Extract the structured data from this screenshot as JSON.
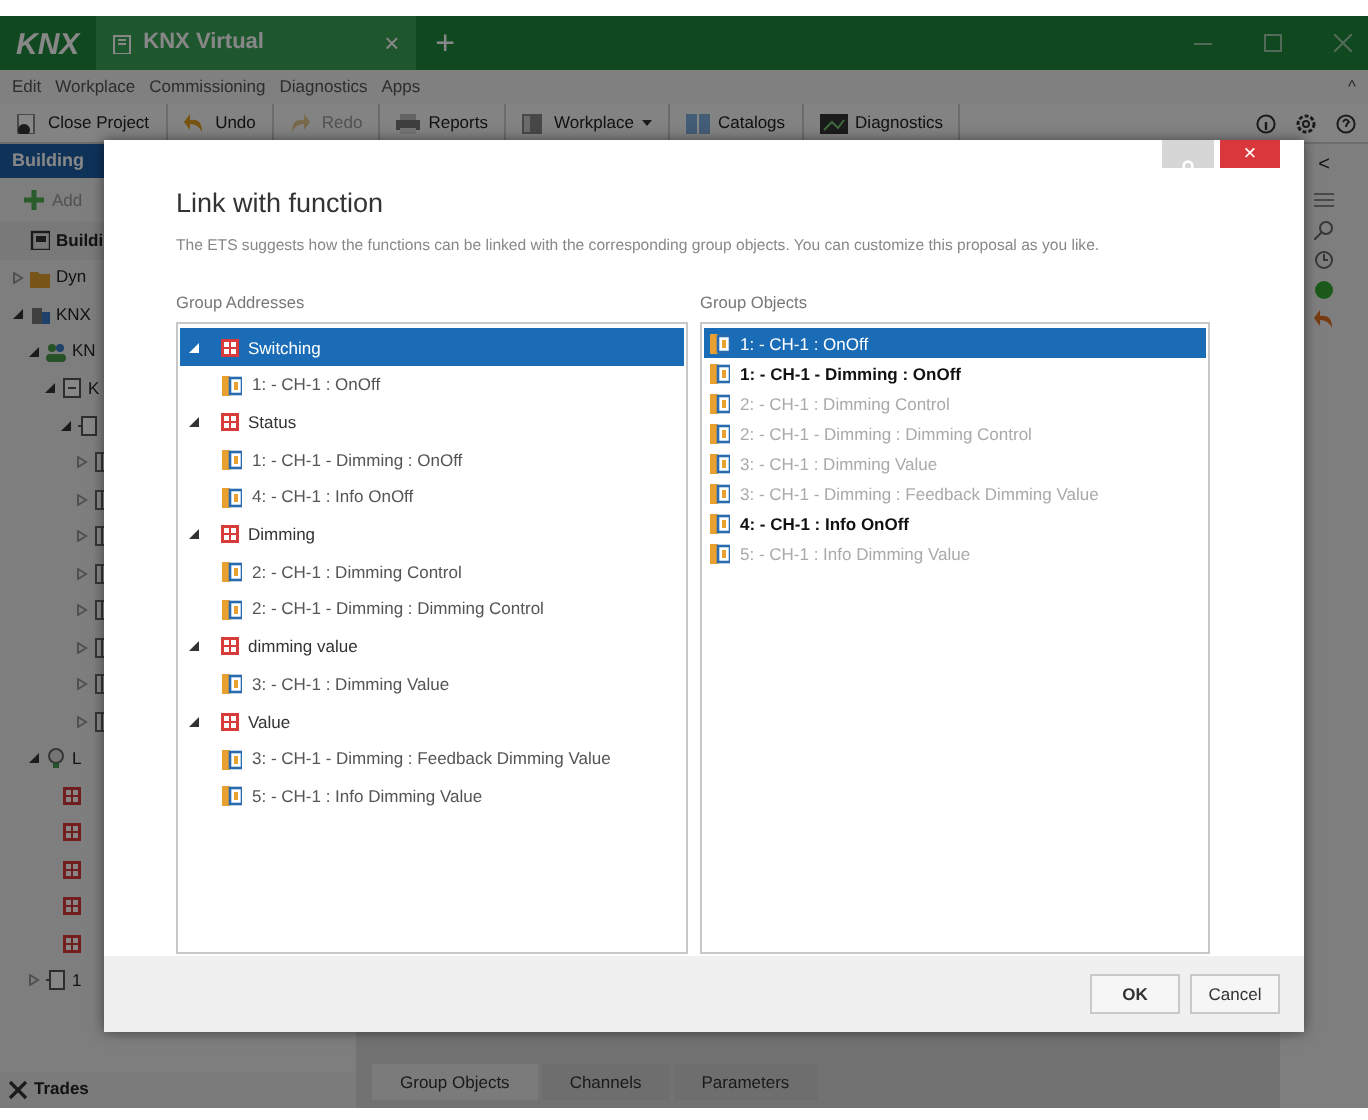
{
  "app": {
    "logo": "KNX",
    "tab": {
      "title": "KNX Virtual",
      "close": "×"
    },
    "new_tab": "+",
    "menu": [
      "Edit",
      "Workplace",
      "Commissioning",
      "Diagnostics",
      "Apps"
    ],
    "menu_collapse": "^",
    "toolbar": [
      {
        "label": "Close Project",
        "kind": "close",
        "disabled": false,
        "dropdown": false
      },
      {
        "label": "Undo",
        "kind": "undo",
        "disabled": false,
        "dropdown": false
      },
      {
        "label": "Redo",
        "kind": "redo",
        "disabled": true,
        "dropdown": false
      },
      {
        "label": "Reports",
        "kind": "printer",
        "disabled": false,
        "dropdown": false
      },
      {
        "label": "Workplace",
        "kind": "panes",
        "disabled": false,
        "dropdown": true
      },
      {
        "label": "Catalogs",
        "kind": "book",
        "disabled": false,
        "dropdown": false
      },
      {
        "label": "Diagnostics",
        "kind": "monitor",
        "disabled": false,
        "dropdown": false
      }
    ],
    "sidebar": {
      "title": "Building",
      "add": "Add",
      "footer": "Trades",
      "tree": [
        {
          "label": "Buildi",
          "kind": "building-view"
        },
        {
          "label": "Dyn",
          "kind": "folder",
          "expanded": false
        },
        {
          "label": "KNX",
          "kind": "building",
          "expanded": true,
          "children": [
            {
              "label": "KN",
              "kind": "people",
              "expanded": true,
              "children": [
                {
                  "label": "K",
                  "kind": "cabinet",
                  "expanded": true,
                  "children": [
                    {
                      "kind": "room",
                      "expanded": true,
                      "children": [
                        {
                          "kind": "device",
                          "expanded": false
                        },
                        {
                          "kind": "device",
                          "expanded": false
                        },
                        {
                          "kind": "device",
                          "expanded": false
                        },
                        {
                          "kind": "device",
                          "expanded": false
                        },
                        {
                          "kind": "device",
                          "expanded": false
                        },
                        {
                          "kind": "device",
                          "expanded": false
                        },
                        {
                          "kind": "device",
                          "expanded": false
                        },
                        {
                          "kind": "device",
                          "expanded": false
                        }
                      ]
                    }
                  ]
                }
              ]
            },
            {
              "label": "L",
              "kind": "bulb",
              "expanded": true,
              "children": [
                {
                  "kind": "group-address"
                },
                {
                  "kind": "group-address"
                },
                {
                  "kind": "group-address"
                },
                {
                  "kind": "group-address"
                },
                {
                  "kind": "group-address"
                }
              ]
            },
            {
              "label": "1",
              "kind": "room",
              "expanded": false
            }
          ]
        }
      ]
    },
    "side_collapse": "<",
    "bottom_tabs": [
      {
        "label": "Group Objects",
        "selected": true
      },
      {
        "label": "Channels",
        "selected": false
      },
      {
        "label": "Parameters",
        "selected": false
      }
    ]
  },
  "dialog": {
    "title": "Link with function",
    "description": "The ETS suggests how the functions can be linked with the corresponding group objects. You can customize this proposal as you like.",
    "group_addresses": {
      "heading": "Group Addresses",
      "tree": [
        {
          "label": "Switching",
          "expanded": true,
          "selected": true,
          "children": [
            {
              "label": "1:  - CH-1 : OnOff"
            }
          ]
        },
        {
          "label": "Status",
          "expanded": true,
          "selected": false,
          "children": [
            {
              "label": "1:  - CH-1 - Dimming : OnOff"
            },
            {
              "label": "4:  - CH-1 : Info OnOff"
            }
          ]
        },
        {
          "label": "Dimming",
          "expanded": true,
          "selected": false,
          "children": [
            {
              "label": "2:  - CH-1 : Dimming Control"
            },
            {
              "label": "2:  - CH-1 - Dimming : Dimming Control"
            }
          ]
        },
        {
          "label": "dimming value",
          "expanded": true,
          "selected": false,
          "children": [
            {
              "label": "3:  - CH-1 : Dimming Value"
            }
          ]
        },
        {
          "label": "Value",
          "expanded": true,
          "selected": false,
          "children": [
            {
              "label": "3:  - CH-1 - Dimming : Feedback Dimming Value"
            },
            {
              "label": "5:  - CH-1 : Info Dimming Value"
            }
          ]
        }
      ]
    },
    "group_objects": {
      "heading": "Group Objects",
      "items": [
        {
          "label": "1:  - CH-1 : OnOff",
          "selected": true,
          "linked": false
        },
        {
          "label": "1:  - CH-1 - Dimming : OnOff",
          "selected": false,
          "linked": true
        },
        {
          "label": "2:  - CH-1 : Dimming Control",
          "selected": false,
          "linked": false
        },
        {
          "label": "2:  - CH-1 - Dimming : Dimming Control",
          "selected": false,
          "linked": false
        },
        {
          "label": "3:  - CH-1 : Dimming Value",
          "selected": false,
          "linked": false
        },
        {
          "label": "3:  - CH-1 - Dimming : Feedback Dimming Value",
          "selected": false,
          "linked": false
        },
        {
          "label": "4:  - CH-1 : Info OnOff",
          "selected": false,
          "linked": true
        },
        {
          "label": "5:  - CH-1 : Info Dimming Value",
          "selected": false,
          "linked": false
        }
      ]
    },
    "close": "×",
    "buttons": [
      "OK",
      "Cancel"
    ]
  }
}
